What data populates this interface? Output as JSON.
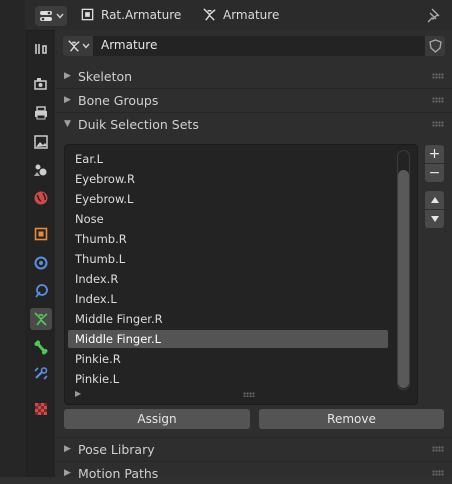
{
  "header": {
    "breadcrumb_object": "Rat.Armature",
    "breadcrumb_data": "Armature"
  },
  "datablock": {
    "name": "Armature"
  },
  "panels": [
    {
      "label": "Skeleton",
      "expanded": false
    },
    {
      "label": "Bone Groups",
      "expanded": false
    },
    {
      "label": "Duik Selection Sets",
      "expanded": true
    }
  ],
  "selection_sets": {
    "items": [
      "Ear.L",
      "Eyebrow.R",
      "Eyebrow.L",
      "Nose",
      "Thumb.R",
      "Thumb.L",
      "Index.R",
      "Index.L",
      "Middle Finger.R",
      "Middle Finger.L",
      "Pinkie.R",
      "Pinkie.L"
    ],
    "selected": "Middle Finger.L",
    "assign_label": "Assign",
    "remove_label": "Remove",
    "add_symbol": "+",
    "remove_symbol": "−"
  },
  "lower_panels": [
    {
      "label": "Pose Library",
      "expanded": false
    },
    {
      "label": "Motion Paths",
      "expanded": false
    }
  ],
  "property_tabs": [
    "tool",
    "render",
    "output",
    "view-layer",
    "scene",
    "world",
    "object",
    "modifiers",
    "particles",
    "physics",
    "object-data-armature",
    "bone",
    "bone-constraints",
    "texture"
  ],
  "active_tab": "object-data-armature",
  "colors": {
    "background": "#303030",
    "selected_row": "#545454",
    "button": "#545454",
    "armature_tab": "#52c55a",
    "object_tab": "#e8893a"
  }
}
